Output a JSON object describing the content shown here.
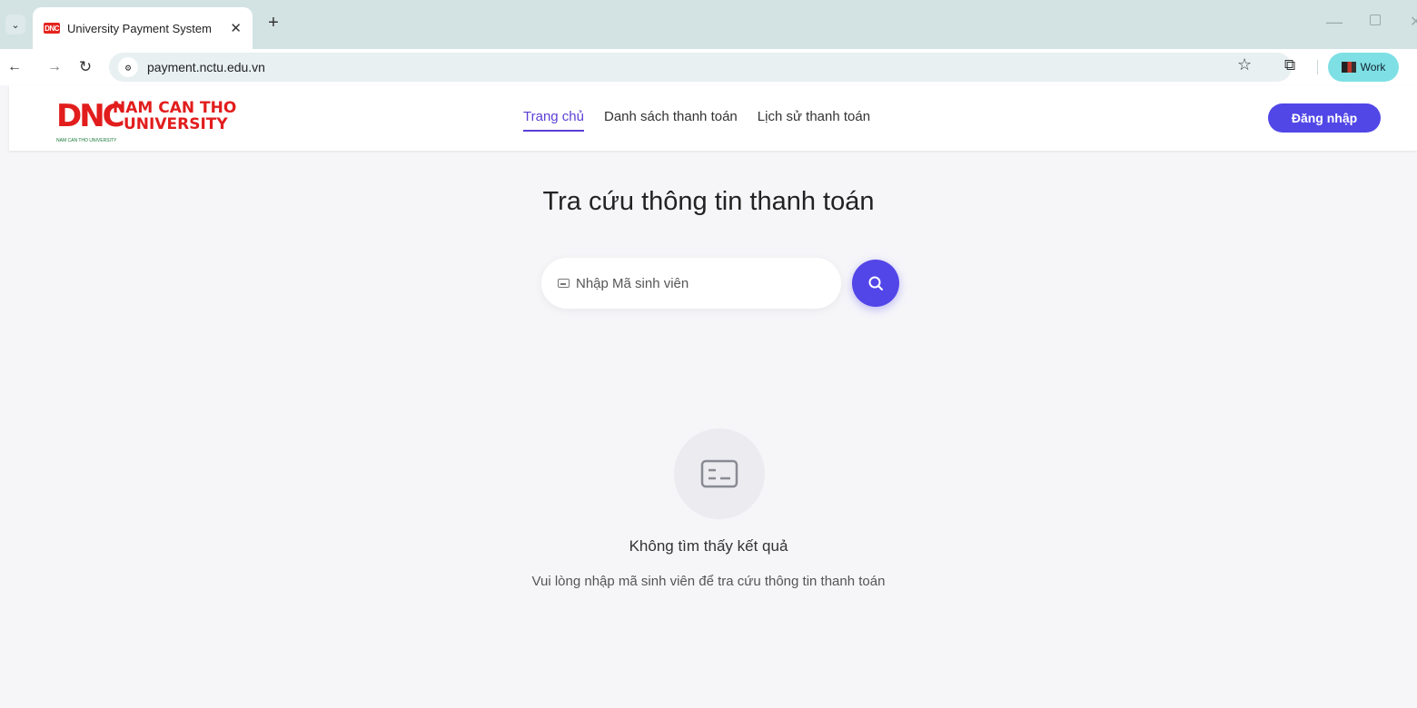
{
  "browser": {
    "tab_title": "University Payment System",
    "tab_close": "✕",
    "new_tab": "+",
    "url": "payment.nctu.edu.vn",
    "profile_label": "Work",
    "favicon_text": "DNC"
  },
  "header": {
    "logo_mark": "DNC",
    "logo_line1": "NAM CAN THO",
    "logo_line2": "UNIVERSITY",
    "logo_tagline": "NAM CAN THO UNIVERSITY",
    "nav": [
      {
        "label": "Trang chủ",
        "active": true
      },
      {
        "label": "Danh sách thanh toán",
        "active": false
      },
      {
        "label": "Lịch sử thanh toán",
        "active": false
      }
    ],
    "login_label": "Đăng nhập"
  },
  "main": {
    "title": "Tra cứu thông tin thanh toán",
    "search_placeholder": "Nhập Mã sinh viên",
    "empty_title": "Không tìm thấy kết quả",
    "empty_subtitle": "Vui lòng nhập mã sinh viên để tra cứu thông tin thanh toán"
  },
  "colors": {
    "accent": "#5147e6",
    "brand_red": "#e21d1d",
    "page_bg": "#f6f6f9"
  }
}
